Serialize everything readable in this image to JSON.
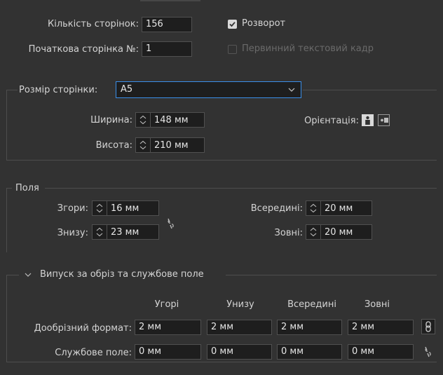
{
  "pages": {
    "count_label": "Кількість сторінок:",
    "count_value": "156",
    "start_label": "Початкова сторінка №:",
    "start_value": "1",
    "facing_label": "Розворот",
    "primary_frame_label": "Первинний текстовий кадр"
  },
  "page_size": {
    "label": "Розмір сторінки:",
    "selected": "A5",
    "width_label": "Ширина:",
    "width_value": "148 мм",
    "height_label": "Висота:",
    "height_value": "210 мм",
    "orientation_label": "Орієнтація:"
  },
  "margins": {
    "title": "Поля",
    "top_label": "Згори:",
    "top_value": "16 мм",
    "bottom_label": "Знизу:",
    "bottom_value": "23 мм",
    "inside_label": "Всередині:",
    "inside_value": "20 мм",
    "outside_label": "Зовні:",
    "outside_value": "20 мм"
  },
  "bleed": {
    "title": "Випуск за обріз та службове поле",
    "columns": [
      "Угорі",
      "Унизу",
      "Всередині",
      "Зовні"
    ],
    "bleed_label": "Дообрізний формат:",
    "bleed_values": [
      "2 мм",
      "2 мм",
      "2 мм",
      "2 мм"
    ],
    "slug_label": "Службове поле:",
    "slug_values": [
      "0 мм",
      "0 мм",
      "0 мм",
      "0 мм"
    ]
  },
  "colors": {
    "background": "#323232",
    "field_bg": "#1e1e1e",
    "accent": "#3a8ee8",
    "text": "#d4d4d4",
    "disabled_text": "#6a6a6a"
  }
}
